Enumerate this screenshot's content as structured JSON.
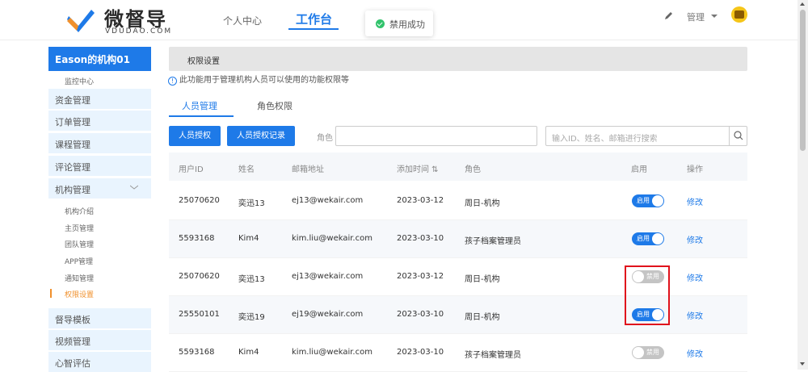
{
  "header": {
    "logo_title": "微督导",
    "logo_sub": "VDUDAO.COM",
    "nav": [
      "个人中心",
      "工作台"
    ],
    "admin_label": "管理",
    "toast": "禁用成功"
  },
  "sidebar": {
    "org": "Eason的机构01",
    "monitor": "监控中心",
    "items_top": [
      "资金管理",
      "订单管理",
      "课程管理",
      "评论管理",
      "机构管理"
    ],
    "sub_items": [
      "机构介绍",
      "主页管理",
      "团队管理",
      "APP管理",
      "通知管理",
      "权限设置"
    ],
    "items_bottom": [
      "督导模板",
      "视频管理",
      "心智评估"
    ]
  },
  "main": {
    "section_title": "权限设置",
    "info_icon": "!",
    "info_text": "此功能用于管理机构人员可以使用的功能权限等",
    "tabs": [
      "人员管理",
      "角色权限"
    ],
    "btn_grant": "人员授权",
    "btn_record": "人员授权记录",
    "role_label": "角色",
    "search_placeholder": "输入ID、姓名、邮箱进行搜索"
  },
  "table": {
    "headers": [
      "用户ID",
      "姓名",
      "邮箱地址",
      "添加时间 ⇅",
      "角色",
      "启用",
      "操作"
    ],
    "rows": [
      {
        "id": "25070620",
        "name": "奕迅13",
        "email": "ej13@wekair.com",
        "date": "2023-03-12",
        "role": "周日-机构",
        "toggle": "启用",
        "action": "修改"
      },
      {
        "id": "5593168",
        "name": "Kim4",
        "email": "kim.liu@wekair.com",
        "date": "2023-03-10",
        "role": "孩子档案管理员",
        "toggle": "启用",
        "action": "修改"
      },
      {
        "id": "25070620",
        "name": "奕迅13",
        "email": "ej13@wekair.com",
        "date": "2023-03-12",
        "role": "周日-机构",
        "toggle": "禁用",
        "action": "修改"
      },
      {
        "id": "25550101",
        "name": "奕迅19",
        "email": "ej19@wekair.com",
        "date": "2023-03-10",
        "role": "周日-机构",
        "toggle": "启用",
        "action": "修改"
      },
      {
        "id": "5593168",
        "name": "Kim4",
        "email": "kim.liu@wekair.com",
        "date": "2023-03-10",
        "role": "孩子档案管理员",
        "toggle": "禁用",
        "action": "修改"
      }
    ]
  },
  "colors": {
    "accent": "#1e7ae8",
    "warning": "#f0902c",
    "highlight": "#e0121c",
    "success": "#32c36c"
  }
}
